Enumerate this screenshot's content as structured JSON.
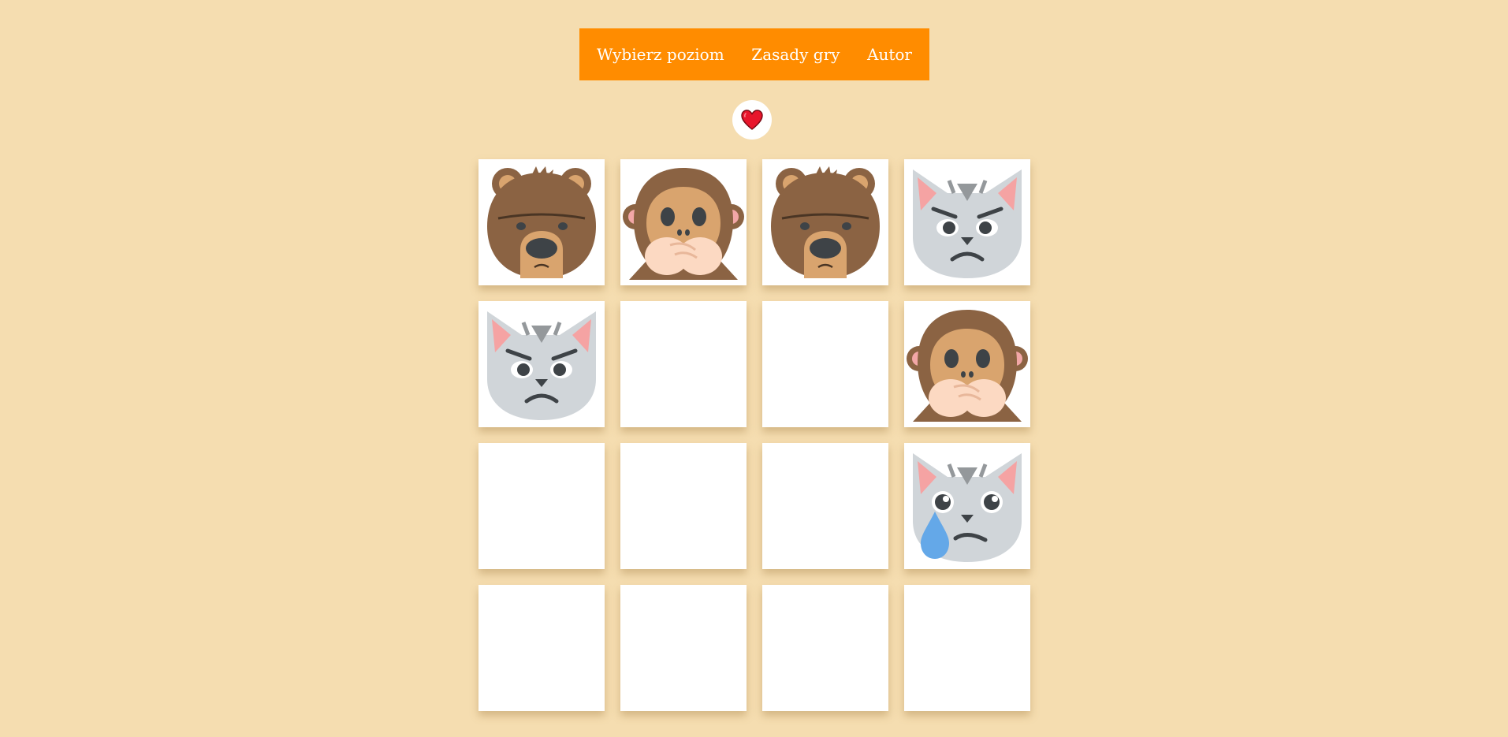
{
  "nav": {
    "items": [
      {
        "label": "Wybierz poziom"
      },
      {
        "label": "Zasady gry"
      },
      {
        "label": "Autor"
      }
    ]
  },
  "status": {
    "lives_icon": "heart-icon",
    "lives_color": "#e8162c"
  },
  "board": {
    "rows": 4,
    "cols": 4,
    "cards": [
      {
        "state": "revealed",
        "face": "bear"
      },
      {
        "state": "revealed",
        "face": "monkey"
      },
      {
        "state": "revealed",
        "face": "bear"
      },
      {
        "state": "revealed",
        "face": "cat-angry"
      },
      {
        "state": "revealed",
        "face": "cat-angry"
      },
      {
        "state": "hidden",
        "face": null
      },
      {
        "state": "hidden",
        "face": null
      },
      {
        "state": "revealed",
        "face": "monkey"
      },
      {
        "state": "hidden",
        "face": null
      },
      {
        "state": "hidden",
        "face": null
      },
      {
        "state": "hidden",
        "face": null
      },
      {
        "state": "revealed",
        "face": "cat-crying"
      },
      {
        "state": "hidden",
        "face": null
      },
      {
        "state": "hidden",
        "face": null
      },
      {
        "state": "hidden",
        "face": null
      },
      {
        "state": "hidden",
        "face": null
      }
    ]
  }
}
